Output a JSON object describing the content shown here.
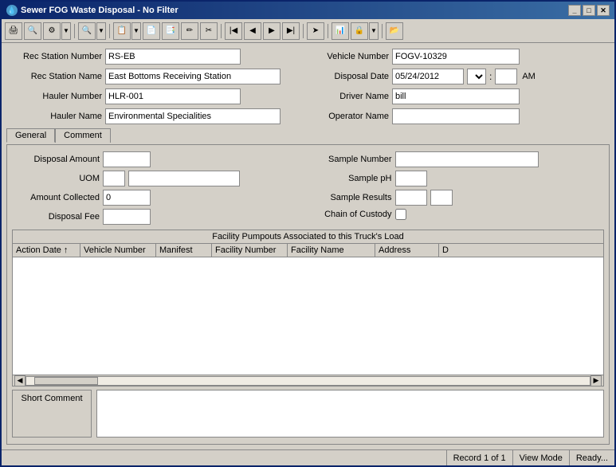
{
  "window": {
    "title": "Sewer FOG Waste Disposal - No Filter",
    "icon": "💧"
  },
  "titlebar": {
    "min_label": "_",
    "max_label": "□",
    "close_label": "✕"
  },
  "toolbar": {
    "buttons": [
      "🖨",
      "🔍",
      "⚙",
      "▼",
      "🔍",
      "▼",
      "📋",
      "▼",
      "📄",
      "📑",
      "✏",
      "✂",
      "⬛",
      "◀",
      "◀",
      "▶",
      "▶",
      "➤",
      "📌",
      "📊",
      "🔒",
      "▼",
      "📂"
    ]
  },
  "form": {
    "rec_station_number_label": "Rec Station Number",
    "rec_station_number_value": "RS-EB",
    "rec_station_name_label": "Rec Station Name",
    "rec_station_name_value": "East Bottoms Receiving Station",
    "hauler_number_label": "Hauler Number",
    "hauler_number_value": "HLR-001",
    "hauler_name_label": "Hauler Name",
    "hauler_name_value": "Environmental Specialities",
    "vehicle_number_label": "Vehicle Number",
    "vehicle_number_value": "FOGV-10329",
    "disposal_date_label": "Disposal Date",
    "disposal_date_value": "05/24/2012",
    "disposal_time_value": "AM",
    "driver_name_label": "Driver Name",
    "driver_name_value": "bill",
    "operator_name_label": "Operator Name",
    "operator_name_value": ""
  },
  "tabs": {
    "general_label": "General",
    "comment_label": "Comment"
  },
  "general_tab": {
    "disposal_amount_label": "Disposal Amount",
    "disposal_amount_value": "",
    "uom_label": "UOM",
    "uom_value1": "",
    "uom_value2": "",
    "amount_collected_label": "Amount Collected",
    "amount_collected_value": "0",
    "disposal_fee_label": "Disposal Fee",
    "disposal_fee_value": "",
    "sample_number_label": "Sample Number",
    "sample_number_value": "",
    "sample_ph_label": "Sample pH",
    "sample_ph_value": "",
    "sample_results_label": "Sample Results",
    "sample_results_value1": "",
    "sample_results_value2": "",
    "chain_custody_label": "Chain of Custody",
    "chain_custody_checked": false
  },
  "table": {
    "title": "Facility Pumpouts Associated to this Truck's Load",
    "columns": [
      "Action Date",
      "Vehicle Number",
      "Manifest",
      "Facility Number",
      "Facility Name",
      "Address",
      "D"
    ]
  },
  "comment_section": {
    "label": "Short Comment",
    "value": ""
  },
  "status_bar": {
    "record": "Record 1 of 1",
    "mode": "View Mode",
    "status": "Ready..."
  }
}
